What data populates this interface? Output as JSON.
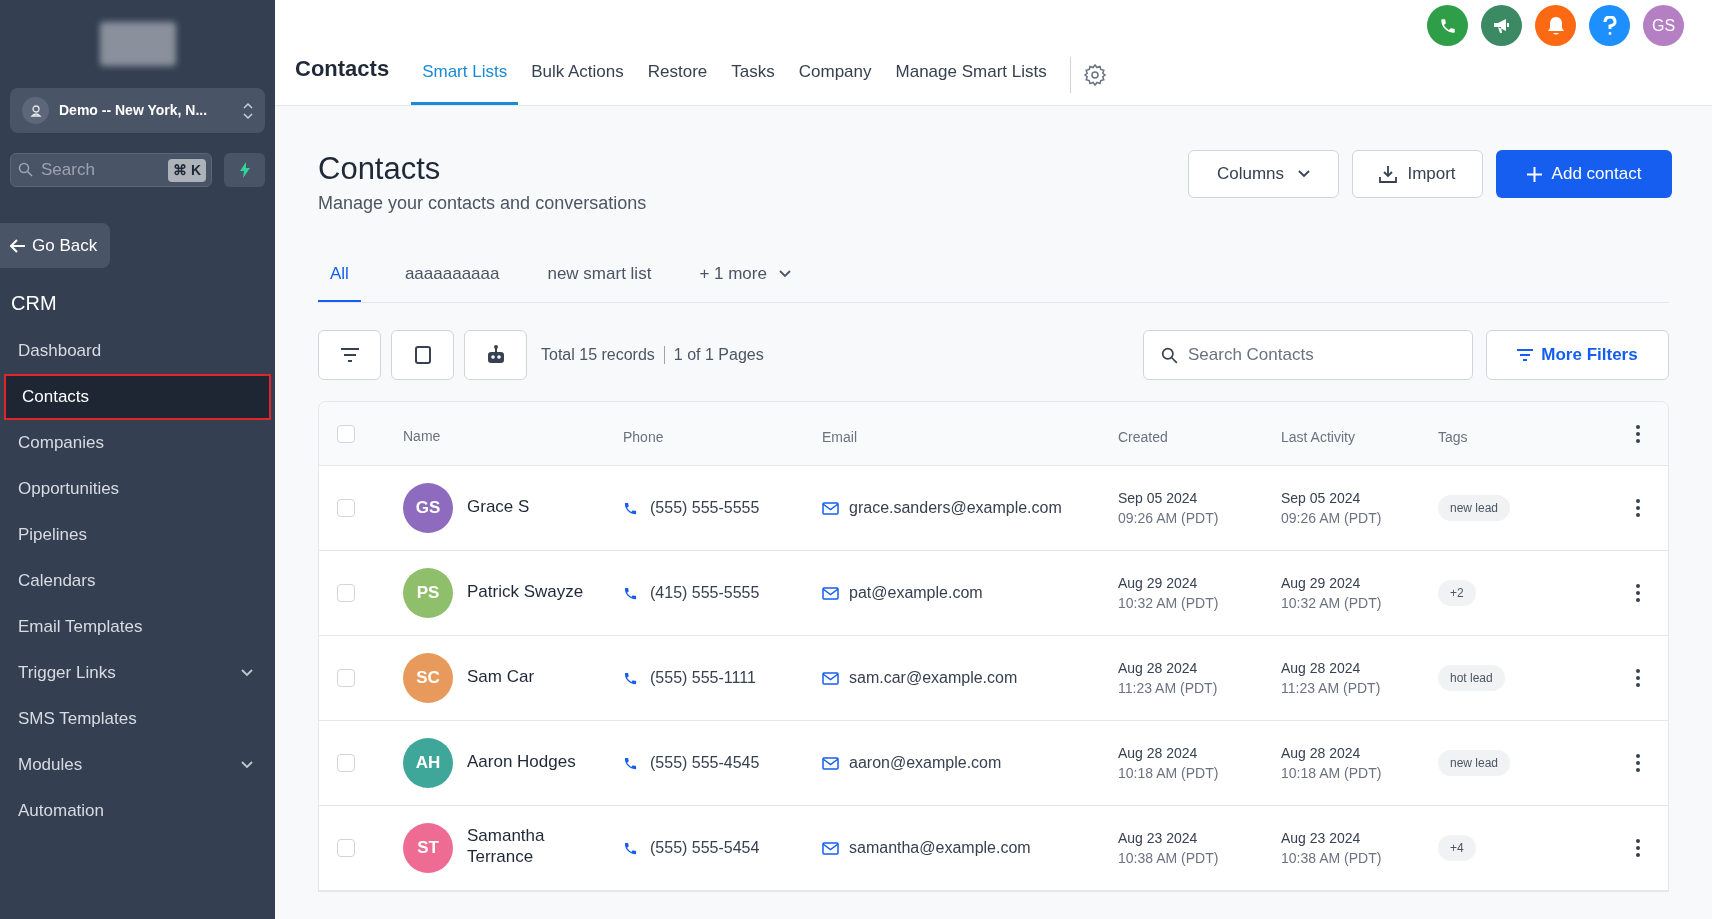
{
  "sidebar": {
    "location": "Demo -- New York, N...",
    "search": {
      "placeholder": "Search",
      "shortcut": "⌘ K"
    },
    "go_back": "Go Back",
    "section": "CRM",
    "items": [
      {
        "label": "Dashboard",
        "selected": false,
        "kind": "link"
      },
      {
        "label": "Contacts",
        "selected": true,
        "kind": "link"
      },
      {
        "label": "Companies",
        "selected": false,
        "kind": "link"
      },
      {
        "label": "Opportunities",
        "selected": false,
        "kind": "link"
      },
      {
        "label": "Pipelines",
        "selected": false,
        "kind": "link"
      },
      {
        "label": "Calendars",
        "selected": false,
        "kind": "link"
      },
      {
        "label": "Email Templates",
        "selected": false,
        "kind": "link"
      },
      {
        "label": "Trigger Links",
        "selected": false,
        "kind": "group"
      },
      {
        "label": "SMS Templates",
        "selected": false,
        "kind": "link"
      },
      {
        "label": "Modules",
        "selected": false,
        "kind": "group"
      },
      {
        "label": "Automation",
        "selected": false,
        "kind": "link"
      }
    ]
  },
  "top_nav": {
    "title": "Contacts",
    "avatar": "GS",
    "tabs": [
      {
        "label": "Smart Lists",
        "selected": true
      },
      {
        "label": "Bulk Actions",
        "selected": false
      },
      {
        "label": "Restore",
        "selected": false
      },
      {
        "label": "Tasks",
        "selected": false
      },
      {
        "label": "Company",
        "selected": false
      },
      {
        "label": "Manage Smart Lists",
        "selected": false
      }
    ]
  },
  "page": {
    "title": "Contacts",
    "subtitle": "Manage your contacts and conversations",
    "buttons": {
      "columns": "Columns",
      "import": "Import",
      "add": "Add contact"
    }
  },
  "list_tabs": [
    {
      "label": "All",
      "selected": true,
      "kind": "list"
    },
    {
      "label": "aaaaaaaaaa",
      "selected": false,
      "kind": "list"
    },
    {
      "label": "new smart list",
      "selected": false,
      "kind": "list"
    },
    {
      "label": "+ 1 more",
      "selected": false,
      "kind": "more"
    }
  ],
  "toolbar": {
    "records": "Total 15 records",
    "pages": "1 of 1 Pages",
    "search_placeholder": "Search Contacts",
    "more_filters": "More Filters"
  },
  "table": {
    "columns": [
      "Name",
      "Phone",
      "Email",
      "Created",
      "Last Activity",
      "Tags"
    ],
    "all_checked": false,
    "rows": [
      {
        "checked": false,
        "initials": "GS",
        "color": "#8e6bbf",
        "name": "Grace S",
        "phone": "(555) 555-5555",
        "email": "grace.sanders@example.com",
        "created_date": "Sep 05 2024",
        "created_time": "09:26 AM (PDT)",
        "activity_date": "Sep 05 2024",
        "activity_time": "09:26 AM (PDT)",
        "tag": "new lead"
      },
      {
        "checked": false,
        "initials": "PS",
        "color": "#8fbf6b",
        "name": "Patrick Swayze",
        "phone": "(415) 555-5555",
        "email": "pat@example.com",
        "created_date": "Aug 29 2024",
        "created_time": "10:32 AM (PDT)",
        "activity_date": "Aug 29 2024",
        "activity_time": "10:32 AM (PDT)",
        "tag": "+2"
      },
      {
        "checked": false,
        "initials": "SC",
        "color": "#e89a5c",
        "name": "Sam Car",
        "phone": "(555) 555-1111",
        "email": "sam.car@example.com",
        "created_date": "Aug 28 2024",
        "created_time": "11:23 AM (PDT)",
        "activity_date": "Aug 28 2024",
        "activity_time": "11:23 AM (PDT)",
        "tag": "hot lead"
      },
      {
        "checked": false,
        "initials": "AH",
        "color": "#3fa69a",
        "name": "Aaron Hodges",
        "phone": "(555) 555-4545",
        "email": "aaron@example.com",
        "created_date": "Aug 28 2024",
        "created_time": "10:18 AM (PDT)",
        "activity_date": "Aug 28 2024",
        "activity_time": "10:18 AM (PDT)",
        "tag": "new lead"
      },
      {
        "checked": false,
        "initials": "ST",
        "color": "#ee6b93",
        "name": "Samantha Terrance",
        "phone": "(555) 555-5454",
        "email": "samantha@example.com",
        "created_date": "Aug 23 2024",
        "created_time": "10:38 AM (PDT)",
        "activity_date": "Aug 23 2024",
        "activity_time": "10:38 AM (PDT)",
        "tag": "+4"
      }
    ]
  }
}
